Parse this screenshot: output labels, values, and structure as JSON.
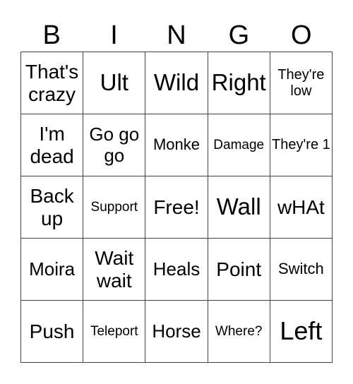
{
  "header": [
    "B",
    "I",
    "N",
    "G",
    "O"
  ],
  "cells": [
    {
      "text": "That's crazy",
      "size": "s-m"
    },
    {
      "text": "Ult",
      "size": "s-l"
    },
    {
      "text": "Wild",
      "size": "s-l"
    },
    {
      "text": "Right",
      "size": "s-l"
    },
    {
      "text": "They're low",
      "size": "s-xs"
    },
    {
      "text": "I'm dead",
      "size": "s-m"
    },
    {
      "text": "Go go go",
      "size": "s-ms"
    },
    {
      "text": "Monke",
      "size": "s-s"
    },
    {
      "text": "Damage",
      "size": "s-xxs"
    },
    {
      "text": "They're 1",
      "size": "s-xs"
    },
    {
      "text": "Back up",
      "size": "s-m"
    },
    {
      "text": "Support",
      "size": "s-xxs"
    },
    {
      "text": "Free!",
      "size": "s-m"
    },
    {
      "text": "Wall",
      "size": "s-l"
    },
    {
      "text": "wHAt",
      "size": "s-m"
    },
    {
      "text": "Moira",
      "size": "s-ms"
    },
    {
      "text": "Wait wait",
      "size": "s-m"
    },
    {
      "text": "Heals",
      "size": "s-ms"
    },
    {
      "text": "Point",
      "size": "s-m"
    },
    {
      "text": "Switch",
      "size": "s-s"
    },
    {
      "text": "Push",
      "size": "s-m"
    },
    {
      "text": "Teleport",
      "size": "s-xxs"
    },
    {
      "text": "Horse",
      "size": "s-ms"
    },
    {
      "text": "Where?",
      "size": "s-xxs"
    },
    {
      "text": "Left",
      "size": "s-xl"
    }
  ]
}
